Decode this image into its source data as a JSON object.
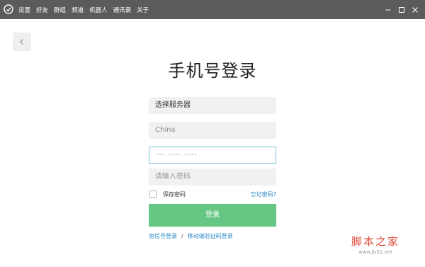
{
  "titlebar": {
    "menu": [
      "设置",
      "好友",
      "群组",
      "频道",
      "机器人",
      "通讯录",
      "关于"
    ],
    "icons": {
      "logo": "chat-bubble-logo",
      "minimize": "minimize-icon",
      "maximize": "maximize-icon",
      "close": "close-icon"
    }
  },
  "page": {
    "title": "手机号登录"
  },
  "form": {
    "server_label": "选择服务器",
    "country_value": "China",
    "phone_placeholder": "--- ---- ----",
    "password_placeholder": "请输入密码",
    "remember_label": "保存密码",
    "forgot_link": "忘记密码?",
    "login_button": "登录"
  },
  "alt_links": {
    "sms_login": "密信号登录",
    "separator": "/",
    "mobile_code_login": "移动端验证码登录"
  },
  "watermark": {
    "title": "脚本之家",
    "url": "www.jb51.net"
  },
  "colors": {
    "titlebar": "#5b5b5b",
    "accent_green": "#66c784",
    "link_blue": "#2d8bc9",
    "focus_border": "#79c2d8"
  }
}
